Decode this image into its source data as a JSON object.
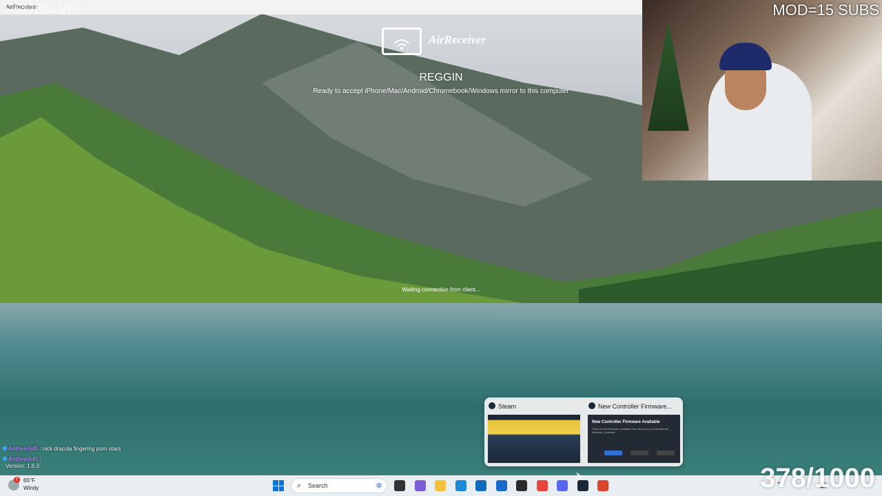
{
  "window": {
    "title": "AirReceiver"
  },
  "overlay": {
    "sub_vip": "FSUB= VIP",
    "mod_subs": "MOD=15 SUBS",
    "goal_counter": "378/1000"
  },
  "airreceiver": {
    "brand": "AirReceiver",
    "device_name": "REGGIN",
    "ready_text": "Ready to accept iPhone/Mac/Android/Chromebook/Windows mirror to this computer",
    "status": "Waiting connection from client..."
  },
  "chat": [
    {
      "user": "Anthem545",
      "message": "nick dracula fingering porn stars"
    },
    {
      "user": "Anthem545",
      "message": ""
    }
  ],
  "version": "Version: 1.6.3",
  "taskbar_previews": [
    {
      "title": "Steam",
      "icon": "steam-icon"
    },
    {
      "title": "New Controller Firmware...",
      "icon": "steam-icon",
      "thumb_heading": "New Controller Firmware Available",
      "thumb_body": "There is new firmware available from Sony for your DualSense Wireless Controller"
    }
  ],
  "taskbar": {
    "weather_temp": "65°F",
    "weather_cond": "Windy",
    "weather_badge": "6",
    "search_label": "Search",
    "apps": [
      "file-explorer-icon",
      "photos-icon",
      "folder-icon",
      "edge-icon",
      "store-icon",
      "outlook-icon",
      "obs-icon",
      "chrome-icon",
      "discord-icon",
      "steam-icon",
      "airreceiver-icon"
    ],
    "app_colors": [
      "#333333",
      "#7b5cd6",
      "#f3c13a",
      "#1c8ad8",
      "#0f6cbd",
      "#1a6ac9",
      "#2b2b2b",
      "#e8453c",
      "#5865f2",
      "#1b2838",
      "#d9442b"
    ]
  }
}
